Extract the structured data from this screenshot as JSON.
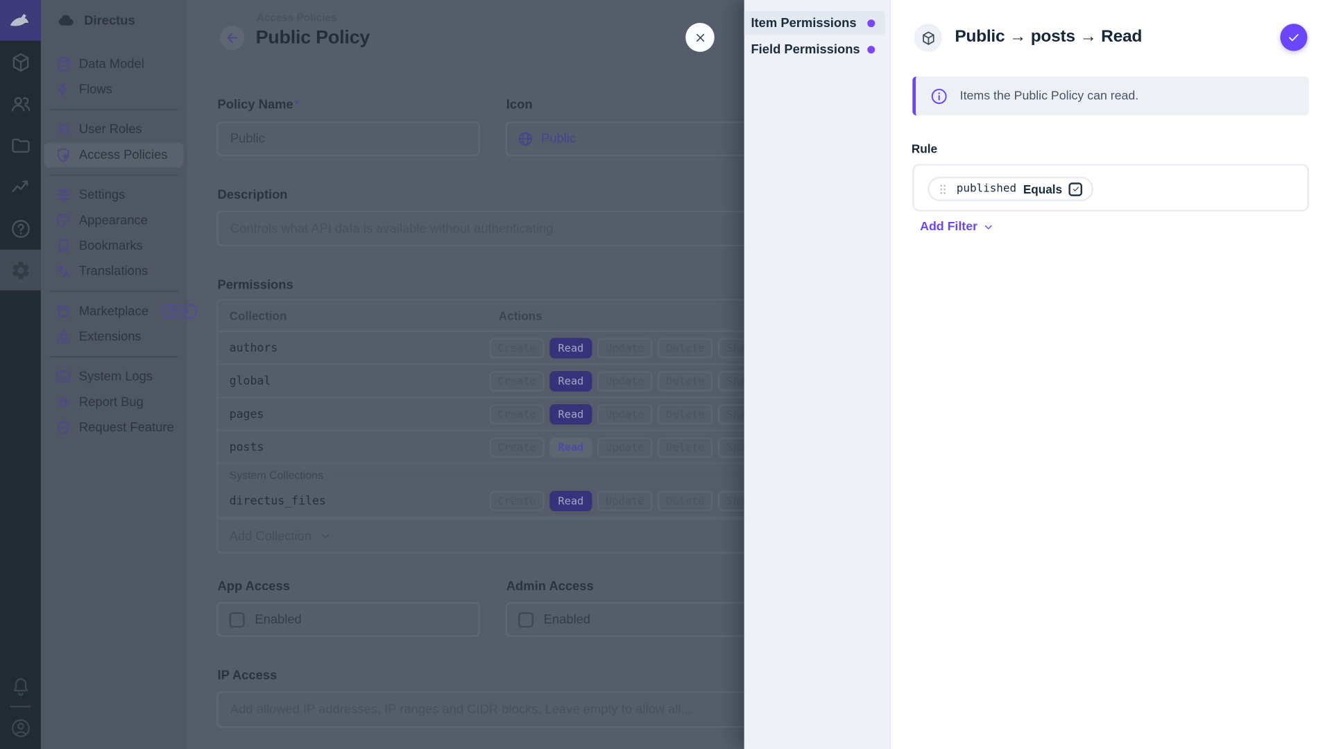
{
  "colors": {
    "accent": "#6644ff",
    "permission_granted": "#6644ff"
  },
  "module_bar": {
    "modules": [
      {
        "name": "content",
        "icon": "box-icon"
      },
      {
        "name": "users",
        "icon": "people-icon"
      },
      {
        "name": "files",
        "icon": "folder-icon"
      },
      {
        "name": "insights",
        "icon": "chart-icon"
      },
      {
        "name": "docs",
        "icon": "help-icon"
      },
      {
        "name": "settings",
        "icon": "gear-icon",
        "active": true
      }
    ],
    "bottom": [
      {
        "name": "notifications",
        "icon": "bell-icon"
      },
      {
        "name": "user-menu",
        "icon": "user-circle-icon"
      }
    ]
  },
  "nav": {
    "project_name": "Directus",
    "sections": [
      {
        "items": [
          {
            "label": "Data Model",
            "icon": "database-icon"
          },
          {
            "label": "Flows",
            "icon": "bolt-icon"
          }
        ]
      },
      {
        "items": [
          {
            "label": "User Roles",
            "icon": "people-icon"
          },
          {
            "label": "Access Policies",
            "icon": "shield-user-icon",
            "active": true
          }
        ]
      },
      {
        "items": [
          {
            "label": "Settings",
            "icon": "tune-icon"
          },
          {
            "label": "Appearance",
            "icon": "palette-icon"
          },
          {
            "label": "Bookmarks",
            "icon": "bookmark-icon"
          },
          {
            "label": "Translations",
            "icon": "translate-icon"
          }
        ]
      },
      {
        "items": [
          {
            "label": "Marketplace",
            "icon": "storefront-icon",
            "badge": "Beta"
          },
          {
            "label": "Extensions",
            "icon": "category-icon"
          }
        ]
      },
      {
        "items": [
          {
            "label": "System Logs",
            "icon": "terminal-icon"
          },
          {
            "label": "Report Bug",
            "icon": "bug-icon"
          },
          {
            "label": "Request Feature",
            "icon": "award-icon"
          }
        ]
      }
    ]
  },
  "page": {
    "breadcrumb": "Access Policies",
    "title": "Public Policy"
  },
  "form": {
    "policy_name": {
      "label": "Policy Name",
      "required_mark": "*",
      "value": "Public"
    },
    "icon_field": {
      "label": "Icon",
      "value": "Public",
      "icon": "globe-icon"
    },
    "description": {
      "label": "Description",
      "value": "Controls what API data is available without authenticating."
    },
    "permissions": {
      "label": "Permissions",
      "columns": {
        "collection": "Collection",
        "actions": "Actions"
      },
      "action_labels": [
        "Create",
        "Read",
        "Update",
        "Delete",
        "Share"
      ],
      "rows": [
        {
          "collection": "authors",
          "granted": [
            "Read"
          ]
        },
        {
          "collection": "global",
          "granted": [
            "Read"
          ]
        },
        {
          "collection": "pages",
          "granted": [
            "Read"
          ]
        },
        {
          "collection": "posts",
          "granted": [],
          "open": "Read"
        }
      ],
      "system_divider": "System Collections",
      "system_rows": [
        {
          "collection": "directus_files",
          "granted": [
            "Read"
          ]
        }
      ],
      "add_label": "Add Collection"
    },
    "app_access": {
      "label": "App Access",
      "checkbox_label": "Enabled",
      "checked": false
    },
    "admin_access": {
      "label": "Admin Access",
      "checkbox_label": "Enabled",
      "checked": false
    },
    "ip_access": {
      "label": "IP Access",
      "placeholder": "Add allowed IP addresses, IP ranges and CIDR blocks. Leave empty to allow all..."
    }
  },
  "drawer": {
    "tabs": [
      {
        "label": "Item Permissions",
        "active": true
      },
      {
        "label": "Field Permissions",
        "active": false
      }
    ],
    "title": {
      "policy": "Public",
      "collection": "posts",
      "action": "Read",
      "separator": "→"
    },
    "banner_text": "Items the Public Policy can read.",
    "rule_label": "Rule",
    "filter": {
      "field": "published",
      "operator": "Equals",
      "checked": true
    },
    "add_filter_label": "Add Filter"
  }
}
